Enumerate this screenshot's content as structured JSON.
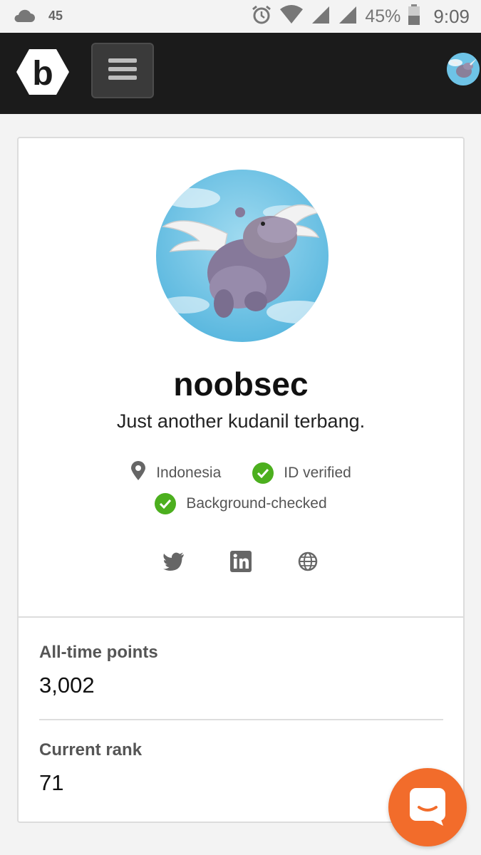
{
  "status_bar": {
    "notification_count": "45",
    "battery": "45%",
    "time": "9:09"
  },
  "nav": {
    "logo_letter": "b",
    "menu_icon": "hamburger-icon",
    "avatar": "user-avatar-hippo"
  },
  "profile": {
    "username": "noobsec",
    "bio": "Just another kudanil terbang.",
    "location": "Indonesia",
    "badges": [
      "ID verified",
      "Background-checked"
    ],
    "social_links": [
      "twitter-icon",
      "linkedin-icon",
      "globe-icon"
    ]
  },
  "stats": [
    {
      "label": "All-time points",
      "value": "3,002"
    },
    {
      "label": "Current rank",
      "value": "71"
    }
  ],
  "colors": {
    "nav_bg": "#1b1b1b",
    "check_green": "#4caf1e",
    "chat_orange": "#f26c2b"
  }
}
